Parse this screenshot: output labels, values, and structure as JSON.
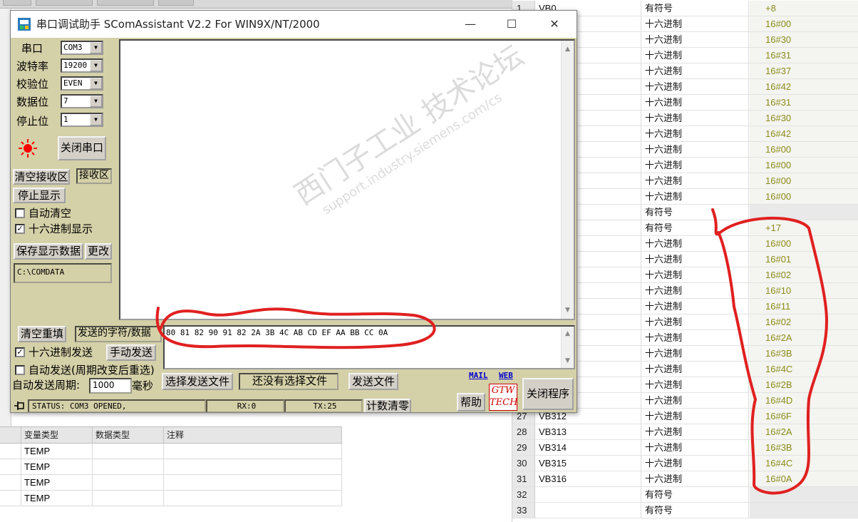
{
  "watch_table": {
    "rows": [
      {
        "num": "1",
        "addr": "VB0",
        "fmt": "有符号",
        "val": "+8"
      },
      {
        "num": "",
        "addr": "",
        "fmt": "十六进制",
        "val": "16#00"
      },
      {
        "num": "",
        "addr": "",
        "fmt": "十六进制",
        "val": "16#30"
      },
      {
        "num": "",
        "addr": "",
        "fmt": "十六进制",
        "val": "16#31"
      },
      {
        "num": "",
        "addr": "",
        "fmt": "十六进制",
        "val": "16#37"
      },
      {
        "num": "",
        "addr": "",
        "fmt": "十六进制",
        "val": "16#42"
      },
      {
        "num": "",
        "addr": "",
        "fmt": "十六进制",
        "val": "16#31"
      },
      {
        "num": "",
        "addr": "",
        "fmt": "十六进制",
        "val": "16#30"
      },
      {
        "num": "",
        "addr": "",
        "fmt": "十六进制",
        "val": "16#42"
      },
      {
        "num": "",
        "addr": "",
        "fmt": "十六进制",
        "val": "16#00"
      },
      {
        "num": "",
        "addr": "",
        "fmt": "十六进制",
        "val": "16#00"
      },
      {
        "num": "",
        "addr": "",
        "fmt": "十六进制",
        "val": "16#00"
      },
      {
        "num": "",
        "addr": "",
        "fmt": "十六进制",
        "val": "16#00"
      },
      {
        "num": "",
        "addr": "",
        "fmt": "有符号",
        "val": ""
      },
      {
        "num": "",
        "addr": "",
        "fmt": "有符号",
        "val": "+17"
      },
      {
        "num": "",
        "addr": "",
        "fmt": "十六进制",
        "val": "16#00"
      },
      {
        "num": "",
        "addr": "",
        "fmt": "十六进制",
        "val": "16#01"
      },
      {
        "num": "",
        "addr": "",
        "fmt": "十六进制",
        "val": "16#02"
      },
      {
        "num": "",
        "addr": "",
        "fmt": "十六进制",
        "val": "16#10"
      },
      {
        "num": "",
        "addr": "",
        "fmt": "十六进制",
        "val": "16#11"
      },
      {
        "num": "",
        "addr": "",
        "fmt": "十六进制",
        "val": "16#02"
      },
      {
        "num": "",
        "addr": "",
        "fmt": "十六进制",
        "val": "16#2A"
      },
      {
        "num": "",
        "addr": "",
        "fmt": "十六进制",
        "val": "16#3B"
      },
      {
        "num": "",
        "addr": "",
        "fmt": "十六进制",
        "val": "16#4C"
      },
      {
        "num": "",
        "addr": "",
        "fmt": "十六进制",
        "val": "16#2B"
      },
      {
        "num": "",
        "addr": "",
        "fmt": "十六进制",
        "val": "16#4D"
      },
      {
        "num": "27",
        "addr": "VB312",
        "fmt": "十六进制",
        "val": "16#6F"
      },
      {
        "num": "28",
        "addr": "VB313",
        "fmt": "十六进制",
        "val": "16#2A"
      },
      {
        "num": "29",
        "addr": "VB314",
        "fmt": "十六进制",
        "val": "16#3B"
      },
      {
        "num": "30",
        "addr": "VB315",
        "fmt": "十六进制",
        "val": "16#4C"
      },
      {
        "num": "31",
        "addr": "VB316",
        "fmt": "十六进制",
        "val": "16#0A"
      },
      {
        "num": "32",
        "addr": "",
        "fmt": "有符号",
        "val": ""
      },
      {
        "num": "33",
        "addr": "",
        "fmt": "有符号",
        "val": ""
      }
    ]
  },
  "var_table": {
    "headers": [
      "变量类型",
      "数据类型",
      "注释"
    ],
    "rows": [
      "TEMP",
      "TEMP",
      "TEMP",
      "TEMP"
    ]
  },
  "app": {
    "title": "串口调试助手 SComAssistant V2.2 For WIN9X/NT/2000",
    "minimize": "—",
    "maximize": "☐",
    "close": "✕"
  },
  "serial": {
    "port_label": "串口",
    "port_value": "COM3",
    "baud_label": "波特率",
    "baud_value": "19200",
    "parity_label": "校验位",
    "parity_value": "EVEN",
    "databits_label": "数据位",
    "databits_value": "7",
    "stopbits_label": "停止位",
    "stopbits_value": "1",
    "close_port": "关闭串口",
    "port_status_color": "#ff0000"
  },
  "receive": {
    "clear_button": "清空接收区",
    "area_label": "接收区",
    "stop_display": "停止显示",
    "auto_clear": "自动清空",
    "hex_display": "十六进制显示",
    "save_button": "保存显示数据",
    "change_button": "更改",
    "save_path": "C:\\COMDATA"
  },
  "send": {
    "clear_refill": "清空重填",
    "label": "发送的字符/数据",
    "data": "80 81 82 90 91 82 2A 3B 4C AB CD EF AA BB CC 0A",
    "hex_send": "十六进制发送",
    "manual_send": "手动发送",
    "auto_send": "自动发送(周期改变后重选)",
    "period_label": "自动发送周期:",
    "period_value": "1000",
    "ms_label": "毫秒",
    "select_file": "选择发送文件",
    "no_file": "还没有选择文件",
    "send_file": "发送文件",
    "close_program": "关闭程序",
    "help": "帮助",
    "mail_link": "MAIL",
    "web_link": "WEB"
  },
  "status": {
    "text": "STATUS: COM3 OPENED,",
    "rx": "RX:0",
    "tx": "TX:25",
    "reset_count": "计数清零"
  },
  "colors": {
    "window_bg": "#d4d0a8",
    "annotation": "#e02020",
    "watch_value": "#8b8b1d"
  }
}
